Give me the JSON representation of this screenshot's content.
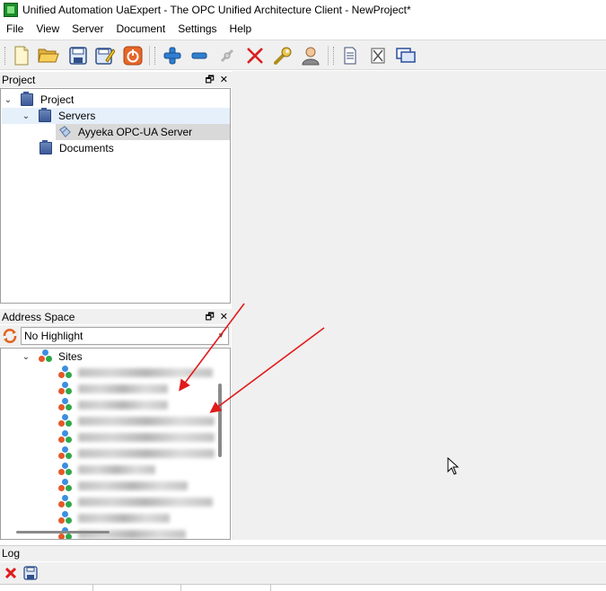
{
  "window": {
    "title": "Unified Automation UaExpert - The OPC Unified Architecture Client - NewProject*"
  },
  "menubar": {
    "items": [
      "File",
      "View",
      "Server",
      "Document",
      "Settings",
      "Help"
    ]
  },
  "toolbar": {
    "buttons": [
      {
        "name": "new-project",
        "icon": "new-document-icon"
      },
      {
        "name": "open-project",
        "icon": "open-folder-icon"
      },
      {
        "name": "save-project",
        "icon": "save-icon"
      },
      {
        "name": "save-as-project",
        "icon": "save-as-icon"
      },
      {
        "name": "power",
        "icon": "power-icon"
      },
      {
        "name": "add-server",
        "icon": "plus-icon"
      },
      {
        "name": "remove-server",
        "icon": "minus-icon"
      },
      {
        "name": "connect-server",
        "icon": "connect-icon"
      },
      {
        "name": "disconnect-server",
        "icon": "disconnect-icon"
      },
      {
        "name": "settings",
        "icon": "wrench-icon"
      },
      {
        "name": "user",
        "icon": "user-icon"
      },
      {
        "name": "add-document",
        "icon": "document-icon"
      },
      {
        "name": "remove-document",
        "icon": "remove-document-icon"
      },
      {
        "name": "windows",
        "icon": "windows-icon"
      }
    ]
  },
  "project_panel": {
    "title": "Project",
    "float_glyph": "🗗",
    "close_glyph": "✕",
    "tree": {
      "root": "Project",
      "servers": "Servers",
      "server_item": "Ayyeka OPC-UA Server",
      "documents": "Documents"
    }
  },
  "address_space_panel": {
    "title": "Address Space",
    "float_glyph": "🗗",
    "close_glyph": "✕",
    "highlight_combo": "No Highlight",
    "combo_arrow": "▼",
    "root_node": "Sites",
    "site_count_visible": 11
  },
  "log_panel": {
    "title": "Log"
  },
  "tree_glyphs": {
    "expanded": "⌄"
  },
  "colors": {
    "annotation_arrow": "#e01b1b",
    "selection": "#d9d9d9",
    "hover": "#e5f0fb"
  }
}
